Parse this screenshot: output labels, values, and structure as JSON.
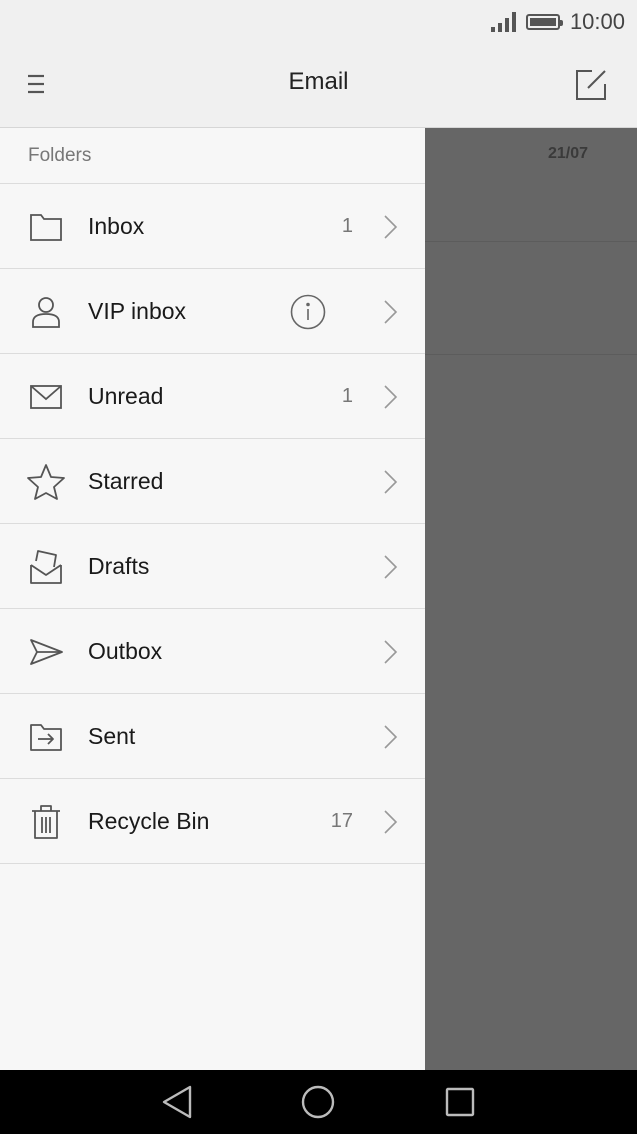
{
  "status_bar": {
    "time": "10:00",
    "icons": [
      "signal-icon",
      "battery-icon"
    ]
  },
  "header": {
    "title": "Email",
    "menu_icon": "menu-icon",
    "compose_icon": "compose-icon"
  },
  "background_list": {
    "date": "21/07"
  },
  "drawer": {
    "section_title": "Folders",
    "folders": [
      {
        "label": "Inbox",
        "count": "1",
        "icon": "folder-icon",
        "info": false
      },
      {
        "label": "VIP inbox",
        "count": "",
        "icon": "person-icon",
        "info": true
      },
      {
        "label": "Unread",
        "count": "1",
        "icon": "envelope-icon",
        "info": false
      },
      {
        "label": "Starred",
        "count": "",
        "icon": "star-icon",
        "info": false
      },
      {
        "label": "Drafts",
        "count": "",
        "icon": "drafts-icon",
        "info": false
      },
      {
        "label": "Outbox",
        "count": "",
        "icon": "send-icon",
        "info": false
      },
      {
        "label": "Sent",
        "count": "",
        "icon": "sent-icon",
        "info": false
      },
      {
        "label": "Recycle Bin",
        "count": "17",
        "icon": "trash-icon",
        "info": false
      }
    ]
  },
  "nav_bar": {
    "buttons": [
      "back-icon",
      "home-icon",
      "recents-icon"
    ]
  },
  "colors": {
    "drawer_bg": "#f7f7f7",
    "scrim": "#666666",
    "nav_bar": "#000000",
    "icon_stroke": "#555555"
  }
}
